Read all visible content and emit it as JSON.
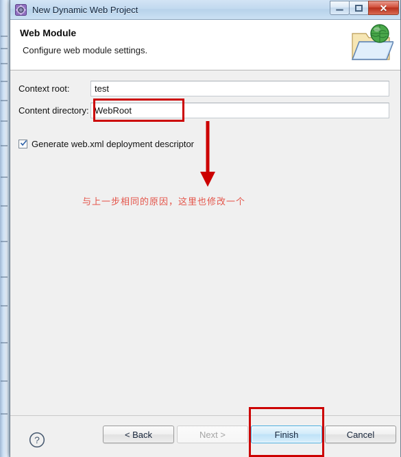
{
  "window": {
    "title": "New Dynamic Web Project",
    "icon": "eclipse-wizard-icon",
    "controls": {
      "minimize_label": "–",
      "maximize_label": "❐",
      "close_label": "✕"
    }
  },
  "header": {
    "title": "Web Module",
    "description": "Configure web module settings.",
    "icon": "web-folder-globe-icon"
  },
  "form": {
    "context_root": {
      "label": "Context root:",
      "value": "test",
      "placeholder": ""
    },
    "content_directory": {
      "label": "Content directory:",
      "value": "WebRoot",
      "placeholder": ""
    },
    "generate_webxml": {
      "label": "Generate web.xml deployment descriptor",
      "checked": true
    }
  },
  "annotations": {
    "note_text": "与上一步相同的原因，这里也修改一个",
    "note_color": "#e4554a",
    "box_color": "#cc0000",
    "arrow_color": "#cc0000",
    "highlight_field": "content_directory",
    "highlight_button": "Finish"
  },
  "footer": {
    "help_icon": "help-question-icon",
    "buttons": {
      "back": {
        "label": "< Back",
        "enabled": true
      },
      "next": {
        "label": "Next >",
        "enabled": false
      },
      "finish": {
        "label": "Finish",
        "enabled": true,
        "default": true
      },
      "cancel": {
        "label": "Cancel",
        "enabled": true
      }
    }
  },
  "colors": {
    "titlebar_top": "#d3e4f5",
    "titlebar_bottom": "#cbe0f3",
    "close_button": "#b8301c",
    "dialog_background": "#f0f0f0",
    "header_background": "#ffffff",
    "primary_button_border": "#3fa9dd",
    "annotation_red": "#cc0000"
  }
}
